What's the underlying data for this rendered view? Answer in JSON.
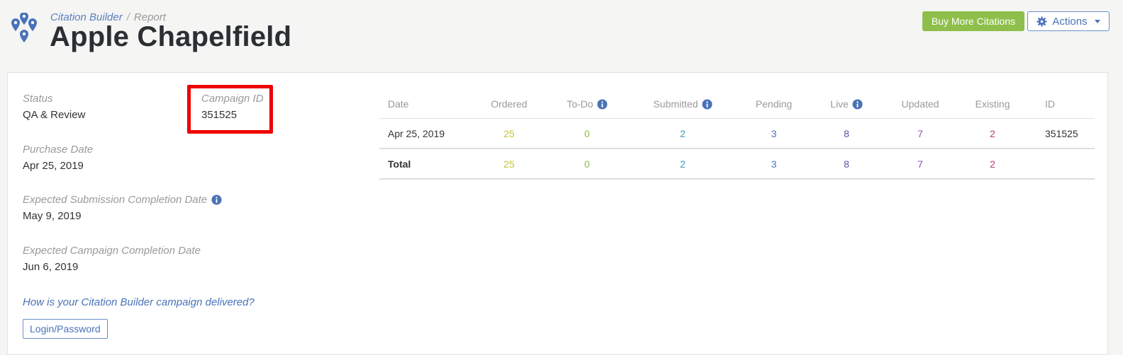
{
  "header": {
    "breadcrumb": {
      "parent": "Citation Builder",
      "separator": "/",
      "current": "Report"
    },
    "title": "Apple Chapelfield",
    "buy_button": "Buy More Citations",
    "actions_button": "Actions"
  },
  "details": {
    "status": {
      "label": "Status",
      "value": "QA & Review"
    },
    "campaign_id": {
      "label": "Campaign ID",
      "value": "351525"
    },
    "purchase_date": {
      "label": "Purchase Date",
      "value": "Apr 25, 2019"
    },
    "expected_submission": {
      "label": "Expected Submission Completion Date",
      "value": "May 9, 2019"
    },
    "expected_campaign": {
      "label": "Expected Campaign Completion Date",
      "value": "Jun 6, 2019"
    },
    "delivery_link": "How is your Citation Builder campaign delivered?",
    "login_button": "Login/Password"
  },
  "table": {
    "headers": {
      "date": "Date",
      "ordered": "Ordered",
      "todo": "To-Do",
      "submitted": "Submitted",
      "pending": "Pending",
      "live": "Live",
      "updated": "Updated",
      "existing": "Existing",
      "id": "ID"
    },
    "row": {
      "date": "Apr 25, 2019",
      "ordered": "25",
      "todo": "0",
      "submitted": "2",
      "pending": "3",
      "live": "8",
      "updated": "7",
      "existing": "2",
      "id": "351525"
    },
    "total": {
      "label": "Total",
      "ordered": "25",
      "todo": "0",
      "submitted": "2",
      "pending": "3",
      "live": "8",
      "updated": "7",
      "existing": "2"
    }
  },
  "colors": {
    "accent_blue": "#4a72b8",
    "buy_green": "#8ebf4a",
    "highlight_red": "#ee0000",
    "ordered": "#c9c43a",
    "todo": "#8ebf4a",
    "submitted": "#3d9bb8",
    "pending": "#4a72b8",
    "live": "#5a52b0",
    "updated": "#9a4fb5",
    "existing": "#b43d78"
  },
  "icons": [
    "map-pins-logo-icon",
    "gear-icon",
    "caret-down-icon",
    "info-icon"
  ]
}
